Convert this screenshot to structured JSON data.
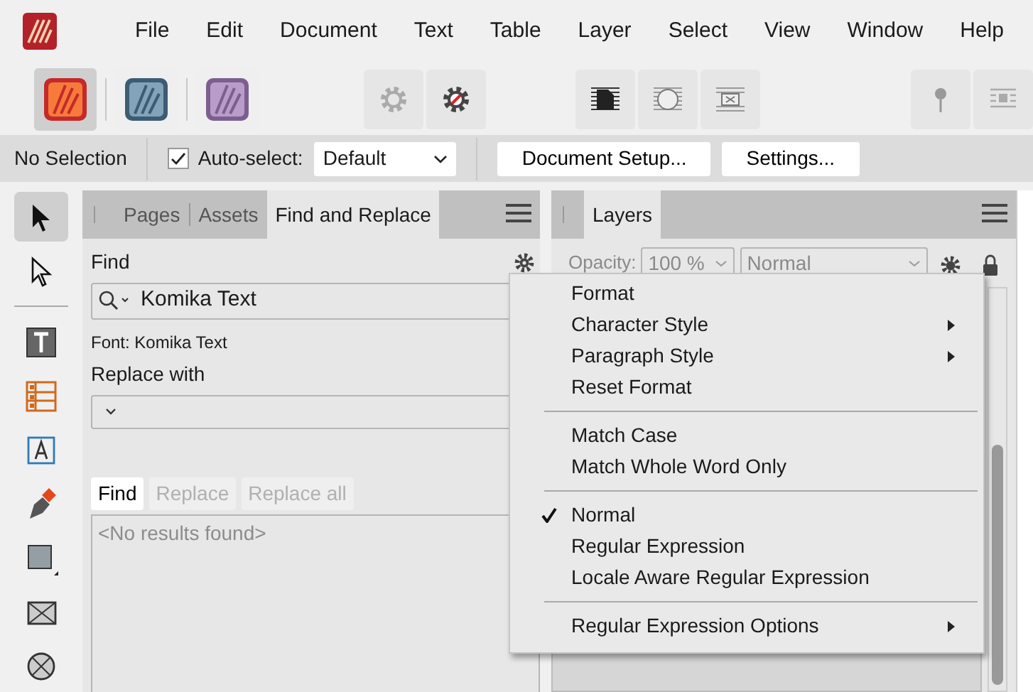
{
  "menu": [
    "File",
    "Edit",
    "Document",
    "Text",
    "Table",
    "Layer",
    "Select",
    "View",
    "Window",
    "Help"
  ],
  "apps": [
    {
      "kind": "publisher",
      "selected": true
    },
    {
      "kind": "designer",
      "selected": false
    },
    {
      "kind": "photo",
      "selected": false
    }
  ],
  "toolbar_groups": [
    {
      "buttons": [
        {
          "kind": "gear"
        },
        {
          "kind": "gear-off"
        }
      ]
    },
    {
      "buttons": [
        {
          "kind": "wrap-square"
        },
        {
          "kind": "wrap-circle"
        },
        {
          "kind": "wrap-none"
        }
      ]
    },
    {
      "buttons": [
        {
          "kind": "pin"
        },
        {
          "kind": "align"
        }
      ]
    }
  ],
  "context_toolbar": {
    "selection": "No Selection",
    "auto_select": {
      "label": "Auto-select:",
      "checked": true
    },
    "mode": "Default",
    "buttons": [
      "Document Setup...",
      "Settings..."
    ]
  },
  "tools": [
    {
      "kind": "move",
      "selected": true
    },
    {
      "kind": "node",
      "selected": false
    },
    {
      "kind": "divider"
    },
    {
      "kind": "text",
      "selected": false
    },
    {
      "kind": "table",
      "selected": false
    },
    {
      "kind": "frame-text",
      "selected": false
    },
    {
      "kind": "pen",
      "selected": false
    },
    {
      "kind": "rect",
      "selected": false
    },
    {
      "kind": "picture",
      "selected": false
    },
    {
      "kind": "circle",
      "selected": false
    }
  ],
  "find_panel": {
    "tabs": [
      {
        "label": "Pages",
        "selected": false
      },
      {
        "label": "Assets",
        "selected": false
      },
      {
        "label": "Find and Replace",
        "selected": true
      }
    ],
    "find_label": "Find",
    "find_value": "Komika Text",
    "font_info": "Font: Komika Text",
    "replace_label": "Replace with",
    "actions": [
      {
        "label": "Find",
        "disabled": false
      },
      {
        "label": "Replace",
        "disabled": true
      },
      {
        "label": "Replace all",
        "disabled": true
      }
    ],
    "results": "<No results found>"
  },
  "layers_panel": {
    "tabs": [
      {
        "label": "Layers",
        "selected": true
      }
    ],
    "opacity_label": "Opacity:",
    "opacity": "100 %",
    "blend": "Normal"
  },
  "context_menu": [
    {
      "kind": "item",
      "label": "Format",
      "submenu": false,
      "checked": false
    },
    {
      "kind": "item",
      "label": "Character Style",
      "submenu": true,
      "checked": false
    },
    {
      "kind": "item",
      "label": "Paragraph Style",
      "submenu": true,
      "checked": false
    },
    {
      "kind": "item",
      "label": "Reset Format",
      "submenu": false,
      "checked": false
    },
    {
      "kind": "separator"
    },
    {
      "kind": "item",
      "label": "Match Case",
      "submenu": false,
      "checked": false
    },
    {
      "kind": "item",
      "label": "Match Whole Word Only",
      "submenu": false,
      "checked": false
    },
    {
      "kind": "separator"
    },
    {
      "kind": "item",
      "label": "Normal",
      "submenu": false,
      "checked": true
    },
    {
      "kind": "item",
      "label": "Regular Expression",
      "submenu": false,
      "checked": false
    },
    {
      "kind": "item",
      "label": "Locale Aware Regular Expression",
      "submenu": false,
      "checked": false
    },
    {
      "kind": "separator"
    },
    {
      "kind": "item",
      "label": "Regular Expression Options",
      "submenu": true,
      "checked": false
    }
  ]
}
